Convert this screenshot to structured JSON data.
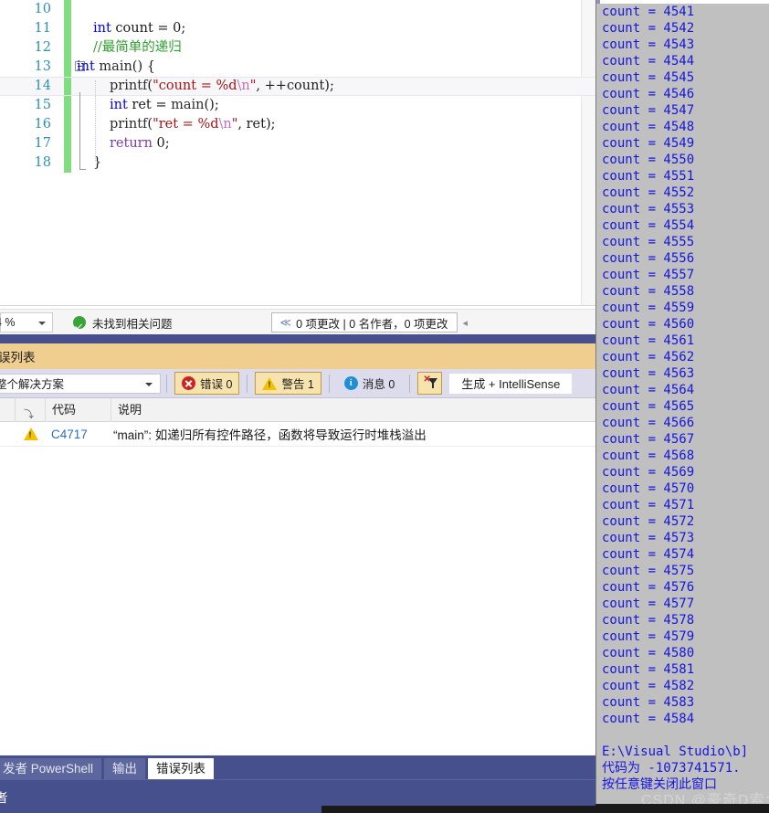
{
  "editor": {
    "lines": [
      {
        "num": "10",
        "segments": []
      },
      {
        "num": "11",
        "indent": 1,
        "segments": [
          {
            "t": "int",
            "c": "kw"
          },
          {
            "t": " count = 0;",
            "c": "plain"
          }
        ]
      },
      {
        "num": "12",
        "indent": 1,
        "segments": [
          {
            "t": "//最简单的递归",
            "c": "com"
          }
        ]
      },
      {
        "num": "13",
        "indent": 0,
        "fold": true,
        "segments": [
          {
            "t": "int",
            "c": "kw"
          },
          {
            "t": " ",
            "c": "plain"
          },
          {
            "t": "main",
            "c": "fn"
          },
          {
            "t": "() {",
            "c": "plain"
          }
        ]
      },
      {
        "num": "14",
        "indent": 2,
        "current": true,
        "segments": [
          {
            "t": "printf",
            "c": "fn"
          },
          {
            "t": "(",
            "c": "plain"
          },
          {
            "t": "\"count = %d",
            "c": "str"
          },
          {
            "t": "\\n",
            "c": "esc"
          },
          {
            "t": "\"",
            "c": "str"
          },
          {
            "t": ", ++count);",
            "c": "plain"
          }
        ]
      },
      {
        "num": "15",
        "indent": 2,
        "segments": [
          {
            "t": "int",
            "c": "kw"
          },
          {
            "t": " ret = ",
            "c": "plain"
          },
          {
            "t": "main",
            "c": "fn"
          },
          {
            "t": "();",
            "c": "plain"
          }
        ]
      },
      {
        "num": "16",
        "indent": 2,
        "segments": [
          {
            "t": "printf",
            "c": "fn"
          },
          {
            "t": "(",
            "c": "plain"
          },
          {
            "t": "\"ret = %d",
            "c": "str"
          },
          {
            "t": "\\n",
            "c": "esc"
          },
          {
            "t": "\"",
            "c": "str"
          },
          {
            "t": ", ret);",
            "c": "plain"
          }
        ]
      },
      {
        "num": "17",
        "indent": 2,
        "segments": [
          {
            "t": "return",
            "c": "kw2"
          },
          {
            "t": " 0;",
            "c": "plain"
          }
        ]
      },
      {
        "num": "18",
        "indent": 1,
        "segments": [
          {
            "t": "}",
            "c": "plain"
          }
        ]
      }
    ]
  },
  "editor_status": {
    "zoom_value": "4 %",
    "issue_text": "未找到相关问题",
    "git_changes_text": "0 项更改 | 0 名作者，0 项更改",
    "git_chevron": "≪",
    "git_collapse": "◂"
  },
  "error_panel": {
    "title": "误列表",
    "scope_value": "整个解决方案",
    "errors_label": "错误 0",
    "warnings_label": "警告 1",
    "messages_label": "消息 0",
    "build_filter_value": "生成 + IntelliSense",
    "columns": {
      "severity_mark": "⤵",
      "code": "代码",
      "description": "说明"
    },
    "rows": [
      {
        "severity": "warning",
        "code": "C4717",
        "description": "“main”: 如递归所有控件路径，函数将导致运行时堆栈溢出"
      }
    ]
  },
  "bottom_tabs": [
    {
      "label": "发者 PowerShell",
      "active": false
    },
    {
      "label": "输出",
      "active": false
    },
    {
      "label": "错误列表",
      "active": true
    }
  ],
  "status_bar": {
    "text": "者"
  },
  "console": {
    "lines": [
      "count = 4541",
      "count = 4542",
      "count = 4543",
      "count = 4544",
      "count = 4545",
      "count = 4546",
      "count = 4547",
      "count = 4548",
      "count = 4549",
      "count = 4550",
      "count = 4551",
      "count = 4552",
      "count = 4553",
      "count = 4554",
      "count = 4555",
      "count = 4556",
      "count = 4557",
      "count = 4558",
      "count = 4559",
      "count = 4560",
      "count = 4561",
      "count = 4562",
      "count = 4563",
      "count = 4564",
      "count = 4565",
      "count = 4566",
      "count = 4567",
      "count = 4568",
      "count = 4569",
      "count = 4570",
      "count = 4571",
      "count = 4572",
      "count = 4573",
      "count = 4574",
      "count = 4575",
      "count = 4576",
      "count = 4577",
      "count = 4578",
      "count = 4579",
      "count = 4580",
      "count = 4581",
      "count = 4582",
      "count = 4583",
      "count = 4584",
      "",
      "E:\\Visual Studio\\b]",
      "代码为 -1073741571.",
      "按任意键关闭此窗口"
    ]
  },
  "watermark": {
    "text": "CSDN @豪奇D索大"
  },
  "colors": {
    "vs_blue_chrome": "#46508c",
    "error_panel_title": "#efce8f",
    "toolbar_bg": "#dcdcec",
    "console_bg": "#c0c0c0",
    "console_text": "#1515e0",
    "change_bar_green": "#80de80",
    "line_number": "#2b91af",
    "code_link": "#2b6fc0"
  }
}
